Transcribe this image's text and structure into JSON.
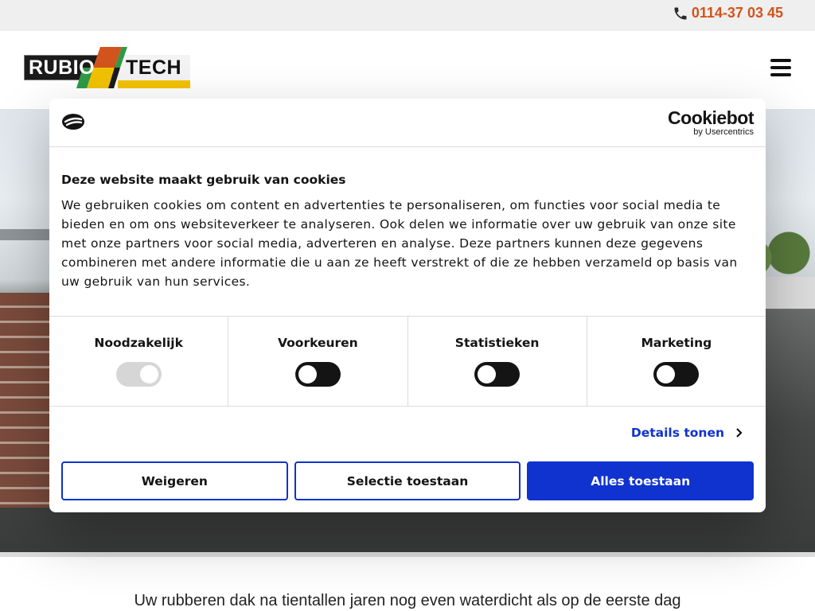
{
  "topbar": {
    "phone": "0114-37 03 45",
    "phone_icon": "phone-icon",
    "phone_color": "#d2541c"
  },
  "header": {
    "logo": {
      "word1": "RUBIO",
      "word2": "TECH",
      "accent_colors": [
        "#d2541c",
        "#2e9a46",
        "#f0c200"
      ]
    },
    "menu_icon": "hamburger-menu-icon"
  },
  "tagline": "Uw rubberen dak na tientallen jaren nog even waterdicht als op de eerste dag",
  "cookie_dialog": {
    "brand": {
      "name": "Cookiebot",
      "sub": "by Usercentrics"
    },
    "title": "Deze website maakt gebruik van cookies",
    "body": "We gebruiken cookies om content en advertenties te personaliseren, om functies voor social media te bieden en om ons websiteverkeer te analyseren. Ook delen we informatie over uw gebruik van onze site met onze partners voor social media, adverteren en analyse. Deze partners kunnen deze gegevens combineren met andere informatie die u aan ze heeft verstrekt of die ze hebben verzameld op basis van uw gebruik van hun services.",
    "toggles": [
      {
        "label": "Noodzakelijk",
        "state": "on-disabled"
      },
      {
        "label": "Voorkeuren",
        "state": "off"
      },
      {
        "label": "Statistieken",
        "state": "off"
      },
      {
        "label": "Marketing",
        "state": "off"
      }
    ],
    "details_link": "Details tonen",
    "buttons": {
      "deny": "Weigeren",
      "selection": "Selectie toestaan",
      "allow_all": "Alles toestaan"
    },
    "accent_color": "#1032cf"
  }
}
